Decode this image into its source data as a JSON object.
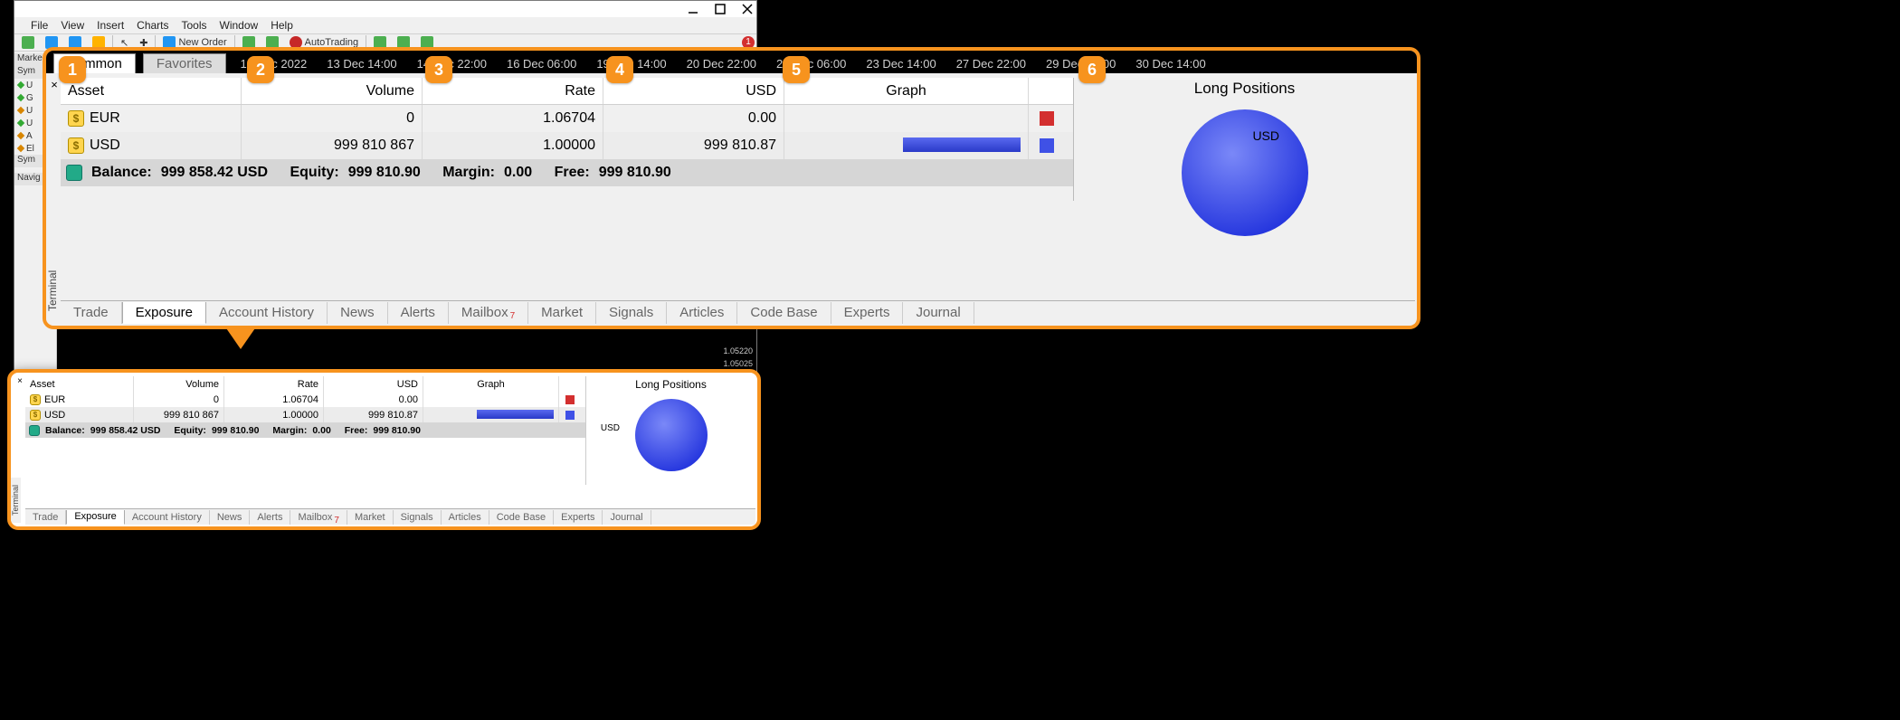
{
  "window": {
    "menu": [
      "File",
      "View",
      "Insert",
      "Charts",
      "Tools",
      "Window",
      "Help"
    ],
    "toolbar": {
      "new_order": "New Order",
      "autotrading": "AutoTrading"
    },
    "dock": {
      "market_header": "Marke",
      "sym_header": "Sym",
      "items": [
        "U",
        "G",
        "U",
        "U",
        "A",
        "El"
      ],
      "sym_footer": "Sym",
      "navig_header": "Navig"
    },
    "prices": [
      "1.05220",
      "1.05025"
    ]
  },
  "callout": {
    "tabs": {
      "common": "Common",
      "favorites": "Favorites"
    },
    "timestrip": [
      "12 Dec 2022",
      "13 Dec 14:00",
      "14 Dec 22:00",
      "16 Dec 06:00",
      "19 Dec 14:00",
      "20 Dec 22:00",
      "22 Dec 06:00",
      "23 Dec 14:00",
      "27 Dec 22:00",
      "29 Dec 06:00",
      "30 Dec 14:00"
    ],
    "columns": {
      "asset": "Asset",
      "volume": "Volume",
      "rate": "Rate",
      "usd": "USD",
      "graph": "Graph",
      "long": "Long Positions"
    },
    "rows": [
      {
        "asset": "EUR",
        "volume": "0",
        "rate": "1.06704",
        "usd": "0.00",
        "swatch": "red"
      },
      {
        "asset": "USD",
        "volume": "999 810 867",
        "rate": "1.00000",
        "usd": "999 810.87",
        "swatch": "blue",
        "bar": true
      }
    ],
    "summary": {
      "balance_label": "Balance:",
      "balance": "999 858.42 USD",
      "equity_label": "Equity:",
      "equity": "999 810.90",
      "margin_label": "Margin:",
      "margin": "0.00",
      "free_label": "Free:",
      "free": "999 810.90"
    },
    "pie_label": "USD",
    "terminal_label": "Terminal",
    "bottom_tabs": [
      "Trade",
      "Exposure",
      "Account History",
      "News",
      "Alerts",
      "Mailbox",
      "Market",
      "Signals",
      "Articles",
      "Code Base",
      "Experts",
      "Journal"
    ],
    "mailbox_badge": "7",
    "badges": [
      "1",
      "2",
      "3",
      "4",
      "5",
      "6"
    ]
  },
  "chart_data": {
    "type": "pie",
    "title": "Long Positions",
    "series": [
      {
        "name": "USD",
        "value": 999810.87,
        "color": "#3f51e6"
      }
    ]
  }
}
